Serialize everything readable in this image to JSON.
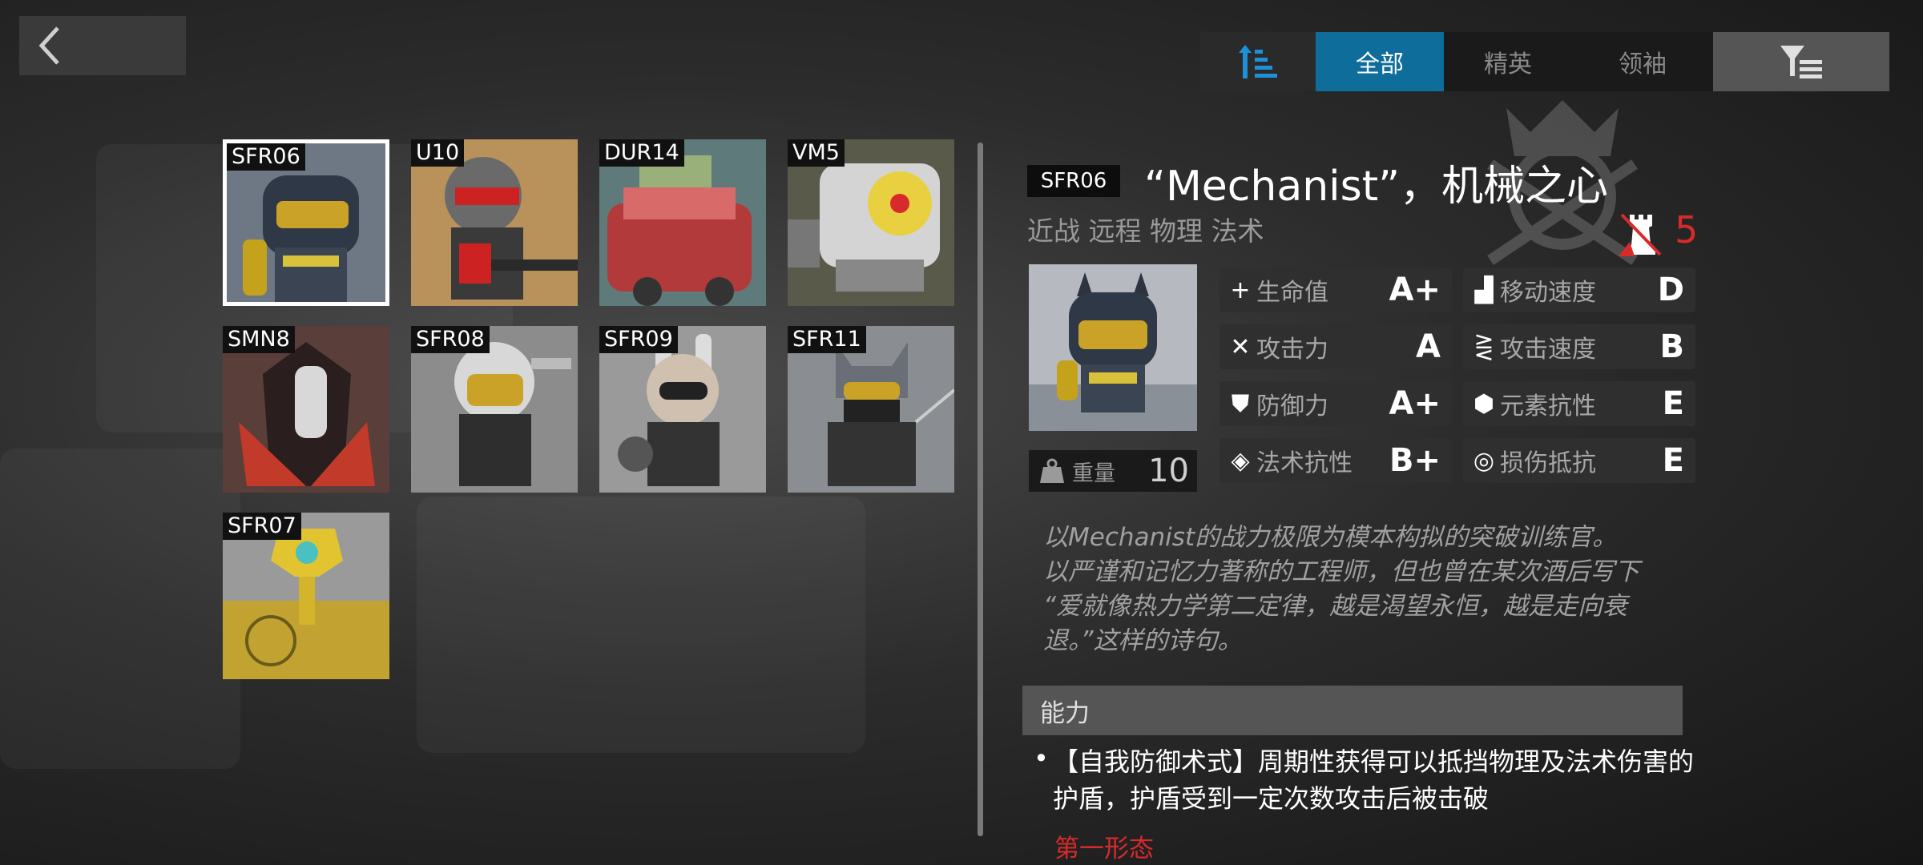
{
  "nav": {
    "back_icon": "chevron-left-icon",
    "sort_icon": "sort-bars-icon",
    "filter_icon": "filter-list-icon",
    "tabs": [
      {
        "label": "全部",
        "active": true
      },
      {
        "label": "精英",
        "active": false
      },
      {
        "label": "领袖",
        "active": false
      }
    ]
  },
  "units": [
    {
      "code": "SFR06",
      "selected": true,
      "color": "#6e7884"
    },
    {
      "code": "U10",
      "selected": false,
      "color": "#8a7a5a"
    },
    {
      "code": "DUR14",
      "selected": false,
      "color": "#6a8a8a"
    },
    {
      "code": "VM5",
      "selected": false,
      "color": "#7a6a4a"
    },
    {
      "code": "SMN8",
      "selected": false,
      "color": "#6a4a4a"
    },
    {
      "code": "SFR08",
      "selected": false,
      "color": "#8a8a8a"
    },
    {
      "code": "SFR09",
      "selected": false,
      "color": "#9a9a9a"
    },
    {
      "code": "SFR11",
      "selected": false,
      "color": "#8a8e92"
    },
    {
      "code": "SFR07",
      "selected": false,
      "color": "#9a9a9a"
    }
  ],
  "detail": {
    "code": "SFR06",
    "name": "“Mechanist”，机械之心",
    "tags": "近战 远程 物理 法术",
    "cost": "5",
    "weight_label": "重量",
    "weight_value": "10",
    "stats": [
      {
        "label": "生命值",
        "value": "A+",
        "icon": "plus-icon",
        "glyph": "+"
      },
      {
        "label": "移动速度",
        "value": "D",
        "icon": "boot-icon",
        "glyph": "▟"
      },
      {
        "label": "攻击力",
        "value": "A",
        "icon": "crossed-swords-icon",
        "glyph": "✕"
      },
      {
        "label": "攻击速度",
        "value": "B",
        "icon": "speed-lines-icon",
        "glyph": "⋛"
      },
      {
        "label": "防御力",
        "value": "A+",
        "icon": "shield-icon",
        "glyph": "⛊"
      },
      {
        "label": "元素抗性",
        "value": "E",
        "icon": "element-shield-icon",
        "glyph": "⬢"
      },
      {
        "label": "法术抗性",
        "value": "B+",
        "icon": "diamond-icon",
        "glyph": "◈"
      },
      {
        "label": "损伤抵抗",
        "value": "E",
        "icon": "ring-icon",
        "glyph": "◎"
      }
    ],
    "description": [
      "以Mechanist的战力极限为模本构拟的突破训练官。",
      "以严谨和记忆力著称的工程师，但也曾在某次酒后写下",
      "“爱就像热力学第二定律，越是渴望永恒，越是走向衰",
      "退。”这样的诗句。"
    ],
    "ability_header": "能力",
    "ability_text": "【自我防御术式】周期性获得可以抵挡物理及法术伤害的护盾，护盾受到一定次数攻击后被击破",
    "form_label": "第一形态"
  }
}
